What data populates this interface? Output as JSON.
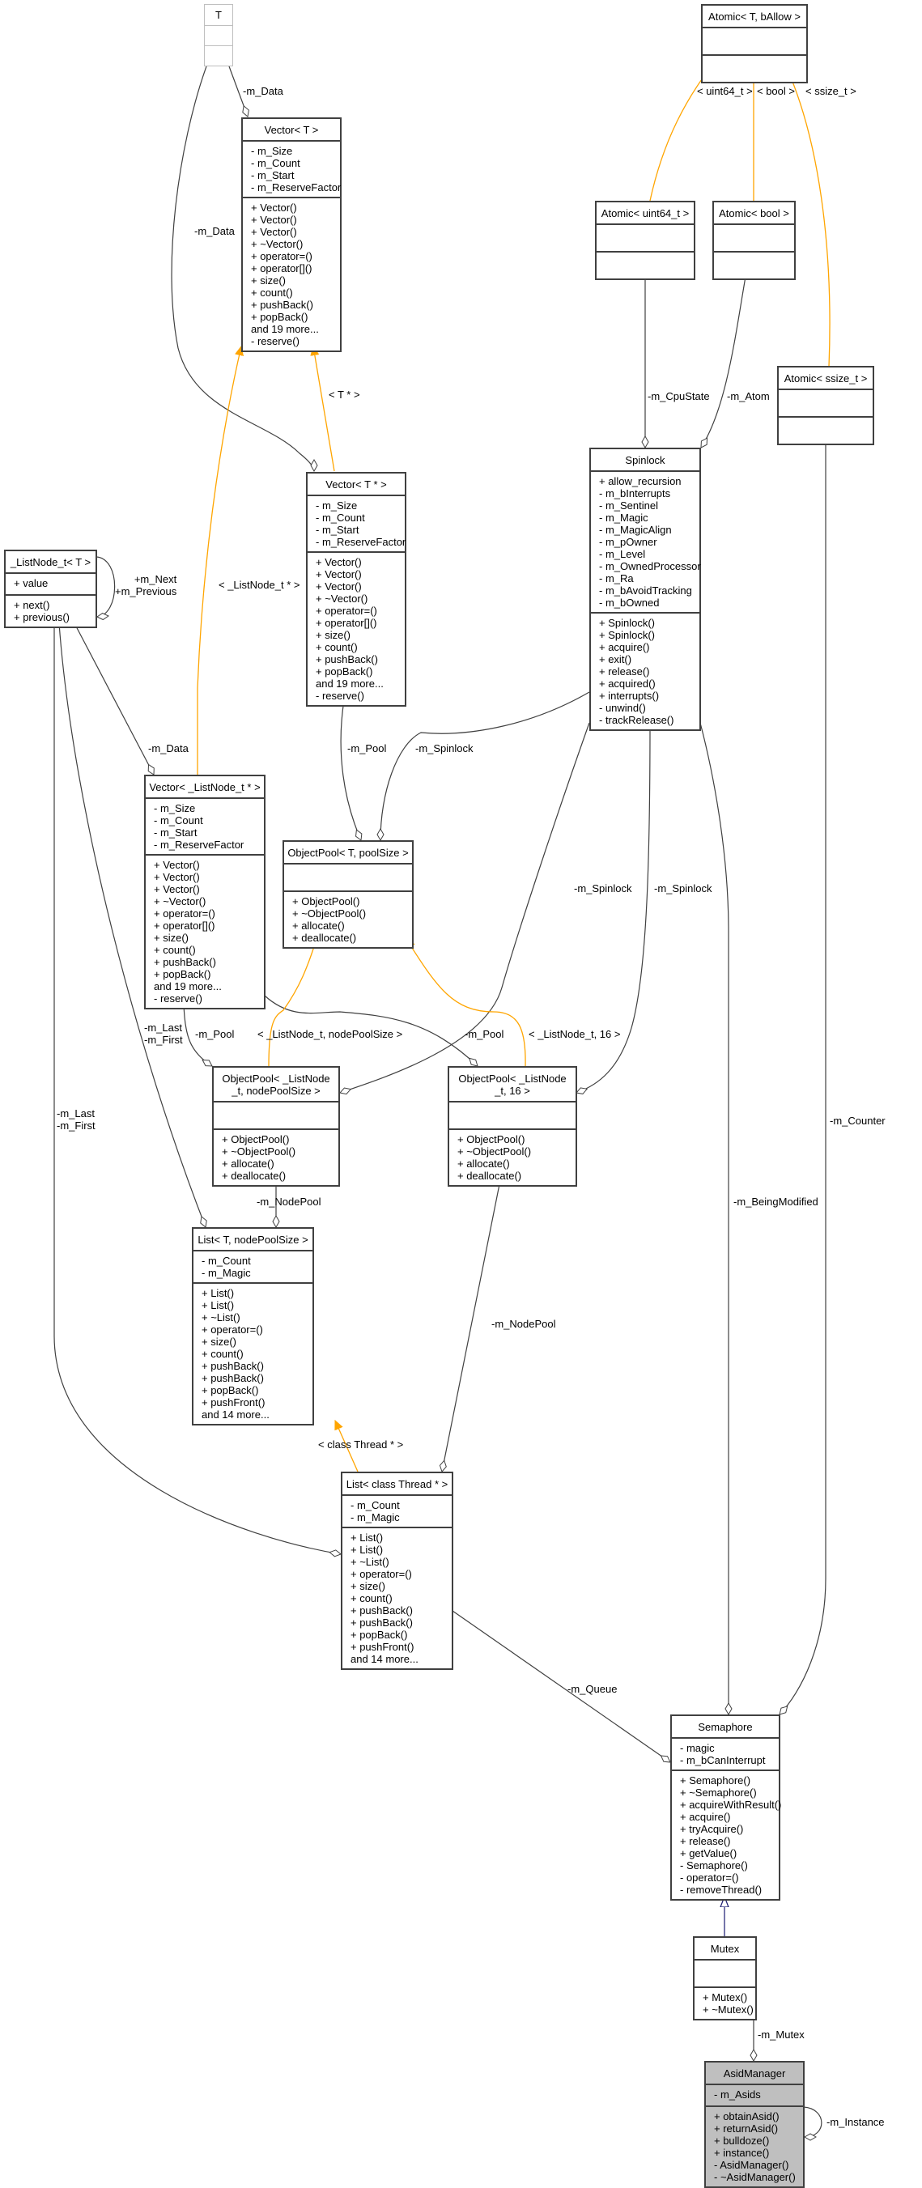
{
  "diagram": {
    "type": "collaboration-diagram",
    "focus_class": "AsidManager",
    "colors": {
      "composition": "#404040",
      "template": "#ffa500",
      "inheritance": "#191970",
      "focus_fill": "#bfbfbf"
    },
    "classes": {
      "T": {
        "title": "T",
        "attributes": [],
        "methods": []
      },
      "vectorT": {
        "title": "Vector< T >",
        "attributes": [
          "- m_Size",
          "- m_Count",
          "- m_Start",
          "- m_ReserveFactor"
        ],
        "methods": [
          "+ Vector()",
          "+ Vector()",
          "+ Vector()",
          "+ ~Vector()",
          "+ operator=()",
          "+ operator[]()",
          "+ size()",
          "+ count()",
          "+ pushBack()",
          "+ popBack()",
          "and 19 more...",
          "- reserve()"
        ]
      },
      "atomicT": {
        "title": "Atomic< T, bAllow >",
        "attributes": [],
        "methods": []
      },
      "atomicU64": {
        "title": "Atomic< uint64_t >",
        "attributes": [],
        "methods": []
      },
      "atomicBool": {
        "title": "Atomic< bool >",
        "attributes": [],
        "methods": []
      },
      "atomicSsize": {
        "title": "Atomic< ssize_t >",
        "attributes": [],
        "methods": []
      },
      "spinlock": {
        "title": "Spinlock",
        "attributes": [
          "+ allow_recursion",
          "- m_bInterrupts",
          "- m_Sentinel",
          "- m_Magic",
          "- m_MagicAlign",
          "- m_pOwner",
          "- m_Level",
          "- m_OwnedProcessor",
          "- m_Ra",
          "- m_bAvoidTracking",
          "- m_bOwned"
        ],
        "methods": [
          "+ Spinlock()",
          "+ Spinlock()",
          "+ acquire()",
          "+ exit()",
          "+ release()",
          "+ acquired()",
          "+ interrupts()",
          "- unwind()",
          "- trackRelease()"
        ]
      },
      "vectorTptr": {
        "title": "Vector< T * >",
        "attributes": [
          "- m_Size",
          "- m_Count",
          "- m_Start",
          "- m_ReserveFactor"
        ],
        "methods": [
          "+ Vector()",
          "+ Vector()",
          "+ Vector()",
          "+ ~Vector()",
          "+ operator=()",
          "+ operator[]()",
          "+ size()",
          "+ count()",
          "+ pushBack()",
          "+ popBack()",
          "and 19 more...",
          "- reserve()"
        ]
      },
      "listNode": {
        "title": "_ListNode_t< T >",
        "attributes": [
          "+ value"
        ],
        "methods": [
          "+ next()",
          "+ previous()"
        ]
      },
      "vectorListNode": {
        "title": "Vector< _ListNode_t * >",
        "attributes": [
          "- m_Size",
          "- m_Count",
          "- m_Start",
          "- m_ReserveFactor"
        ],
        "methods": [
          "+ Vector()",
          "+ Vector()",
          "+ Vector()",
          "+ ~Vector()",
          "+ operator=()",
          "+ operator[]()",
          "+ size()",
          "+ count()",
          "+ pushBack()",
          "+ popBack()",
          "and 19 more...",
          "- reserve()"
        ]
      },
      "objectPoolT": {
        "title": "ObjectPool< T, poolSize >",
        "attributes": [],
        "methods": [
          "+ ObjectPool()",
          "+ ~ObjectPool()",
          "+ allocate()",
          "+ deallocate()"
        ]
      },
      "objectPoolNode": {
        "title": "ObjectPool< _ListNode\n_t, nodePoolSize >",
        "attributes": [],
        "methods": [
          "+ ObjectPool()",
          "+ ~ObjectPool()",
          "+ allocate()",
          "+ deallocate()"
        ]
      },
      "objectPool16": {
        "title": "ObjectPool< _ListNode\n_t, 16 >",
        "attributes": [],
        "methods": [
          "+ ObjectPool()",
          "+ ~ObjectPool()",
          "+ allocate()",
          "+ deallocate()"
        ]
      },
      "listT": {
        "title": "List< T, nodePoolSize >",
        "attributes": [
          "- m_Count",
          "- m_Magic"
        ],
        "methods": [
          "+ List()",
          "+ List()",
          "+ ~List()",
          "+ operator=()",
          "+ size()",
          "+ count()",
          "+ pushBack()",
          "+ pushBack()",
          "+ popBack()",
          "+ pushFront()",
          "and 14 more..."
        ]
      },
      "listThread": {
        "title": "List< class Thread * >",
        "attributes": [
          "- m_Count",
          "- m_Magic"
        ],
        "methods": [
          "+ List()",
          "+ List()",
          "+ ~List()",
          "+ operator=()",
          "+ size()",
          "+ count()",
          "+ pushBack()",
          "+ pushBack()",
          "+ popBack()",
          "+ pushFront()",
          "and 14 more..."
        ]
      },
      "semaphore": {
        "title": "Semaphore",
        "attributes": [
          "- magic",
          "- m_bCanInterrupt"
        ],
        "methods": [
          "+ Semaphore()",
          "+ ~Semaphore()",
          "+ acquireWithResult()",
          "+ acquire()",
          "+ tryAcquire()",
          "+ release()",
          "+ getValue()",
          "- Semaphore()",
          "- operator=()",
          "- removeThread()"
        ]
      },
      "mutex": {
        "title": "Mutex",
        "attributes": [],
        "methods": [
          "+ Mutex()",
          "+ ~Mutex()"
        ]
      },
      "asidManager": {
        "title": "AsidManager",
        "attributes": [
          "- m_Asids"
        ],
        "methods": [
          "+ obtainAsid()",
          "+ returnAsid()",
          "+ bulldoze()",
          "+ instance()",
          "- AsidManager()",
          "- ~AsidManager()"
        ]
      }
    },
    "edge_labels": {
      "tData1": "-m_Data",
      "tData2": "-m_Data",
      "tptr": "< T * >",
      "listNodePtr": "< _ListNode_t * >",
      "u64": "< uint64_t >",
      "bool": "< bool >",
      "ssize": "< ssize_t >",
      "cpuState": "-m_CpuState",
      "atom": "-m_Atom",
      "nextPrev": "+m_Next\n+m_Previous",
      "vlnData": "-m_Data",
      "pool1": "-m_Pool",
      "spin1": "-m_Spinlock",
      "spin2": "-m_Spinlock",
      "spin3": "-m_Spinlock",
      "lastFirst1": "-m_Last\n-m_First",
      "lastFirst2": "-m_Last\n-m_First",
      "pool2": "-m_Pool",
      "pool3": "-m_Pool",
      "tplNodePool": "< _ListNode_t, nodePoolSize >",
      "tpl16": "< _ListNode_t, 16 >",
      "nodePool1": "-m_NodePool",
      "nodePool2": "-m_NodePool",
      "beingModified": "-m_BeingModified",
      "counter": "-m_Counter",
      "classThread": "< class Thread * >",
      "queue": "-m_Queue",
      "mutexLbl": "-m_Mutex",
      "instance": "-m_Instance"
    }
  }
}
